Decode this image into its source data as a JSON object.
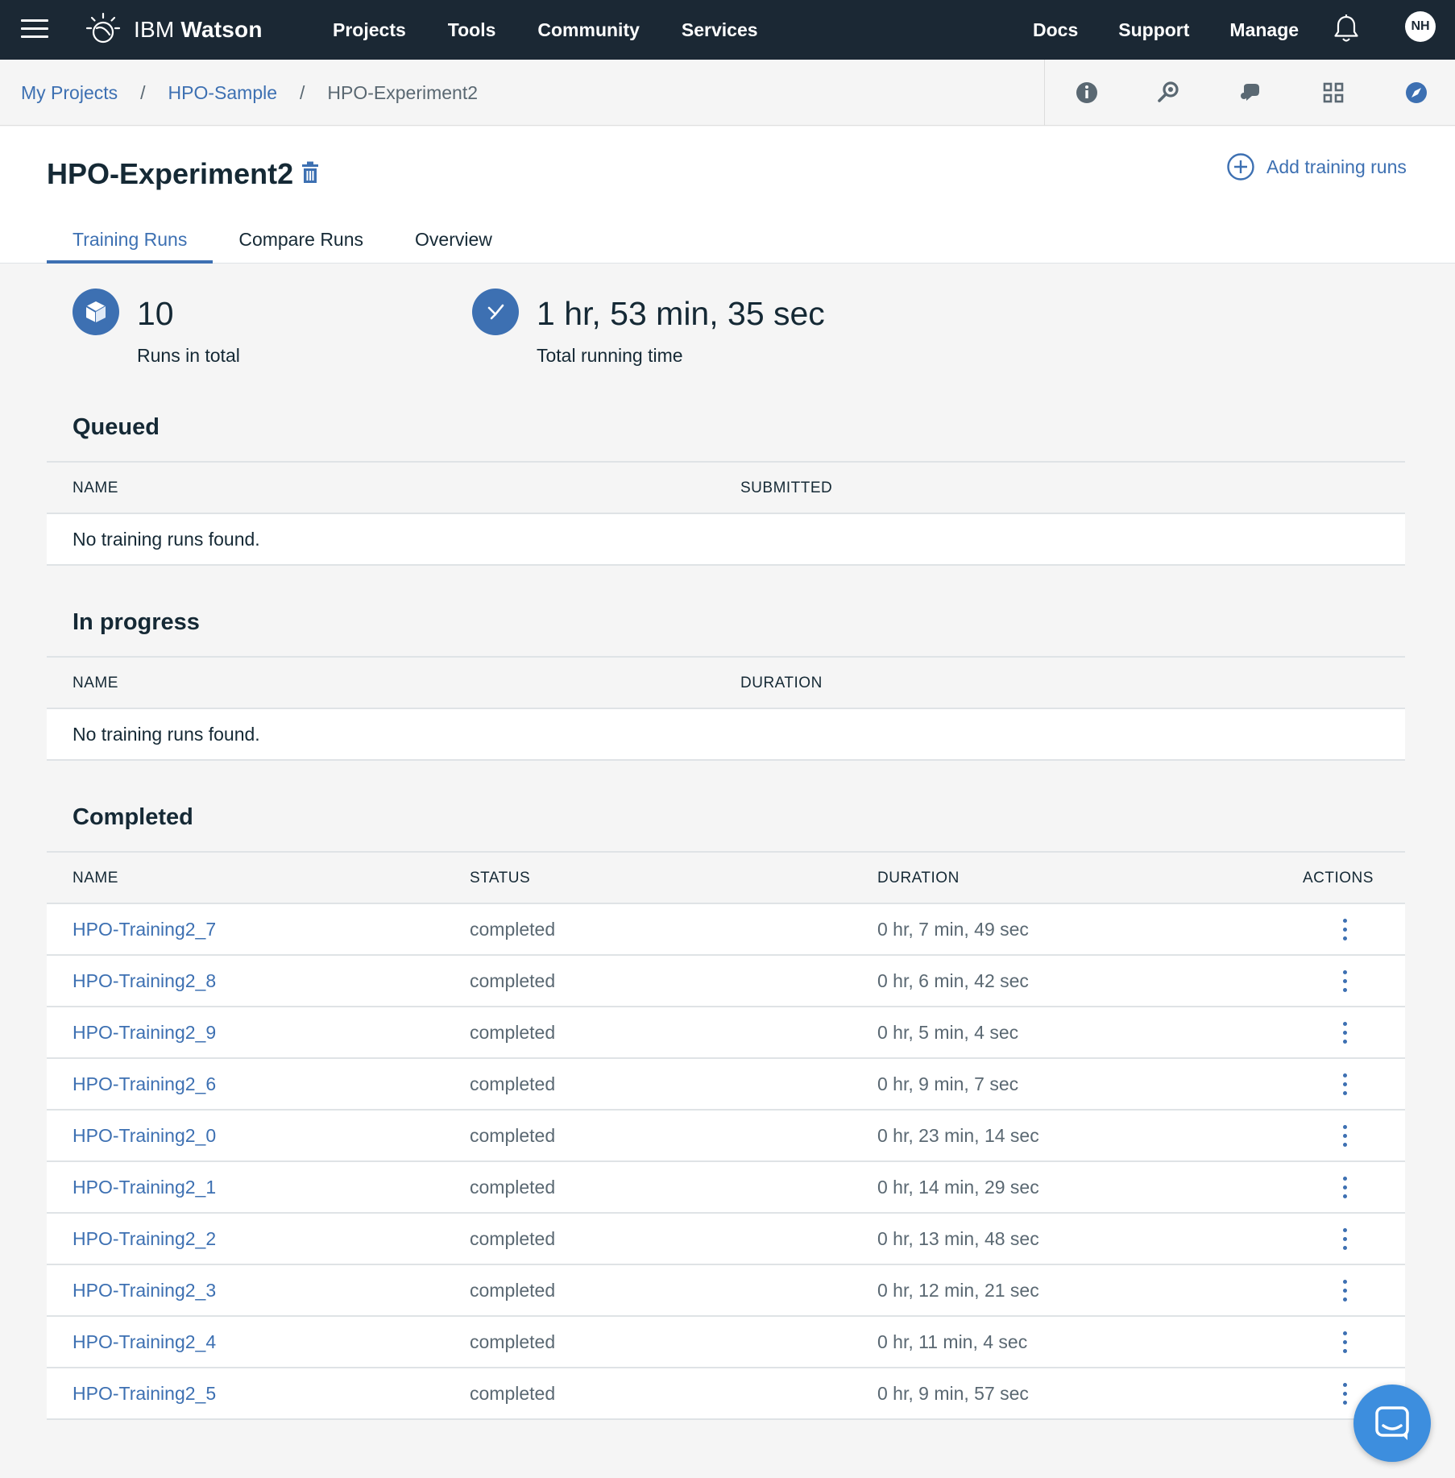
{
  "topnav": {
    "brand_prefix": "IBM",
    "brand_name": "Watson",
    "left_links": [
      "Projects",
      "Tools",
      "Community",
      "Services"
    ],
    "right_links": [
      "Docs",
      "Support",
      "Manage"
    ],
    "avatar_initials": "NH",
    "background": "#1b2834"
  },
  "breadcrumb": {
    "items": [
      "My Projects",
      "HPO-Sample"
    ],
    "current": "HPO-Experiment2",
    "separator": "/"
  },
  "toolbar_icons": [
    "info-icon",
    "search-asset-icon",
    "chat-bubble-icon",
    "grid-icon",
    "compass-icon"
  ],
  "header": {
    "title": "HPO-Experiment2",
    "add_label": "Add training runs",
    "tabs": [
      "Training Runs",
      "Compare Runs",
      "Overview"
    ],
    "active_tab": 0
  },
  "stats": {
    "runs_total": "10",
    "runs_label": "Runs in total",
    "running_time": "1 hr, 53 min, 35 sec",
    "running_label": "Total running time"
  },
  "queued": {
    "title": "Queued",
    "headers": [
      "NAME",
      "SUBMITTED"
    ],
    "empty_text": "No training runs found."
  },
  "in_progress": {
    "title": "In progress",
    "headers": [
      "NAME",
      "DURATION"
    ],
    "empty_text": "No training runs found."
  },
  "completed": {
    "title": "Completed",
    "headers": [
      "NAME",
      "STATUS",
      "DURATION",
      "ACTIONS"
    ],
    "rows": [
      {
        "name": "HPO-Training2_7",
        "status": "completed",
        "duration": "0 hr, 7 min, 49 sec"
      },
      {
        "name": "HPO-Training2_8",
        "status": "completed",
        "duration": "0 hr, 6 min, 42 sec"
      },
      {
        "name": "HPO-Training2_9",
        "status": "completed",
        "duration": "0 hr, 5 min, 4 sec"
      },
      {
        "name": "HPO-Training2_6",
        "status": "completed",
        "duration": "0 hr, 9 min, 7 sec"
      },
      {
        "name": "HPO-Training2_0",
        "status": "completed",
        "duration": "0 hr, 23 min, 14 sec"
      },
      {
        "name": "HPO-Training2_1",
        "status": "completed",
        "duration": "0 hr, 14 min, 29 sec"
      },
      {
        "name": "HPO-Training2_2",
        "status": "completed",
        "duration": "0 hr, 13 min, 48 sec"
      },
      {
        "name": "HPO-Training2_3",
        "status": "completed",
        "duration": "0 hr, 12 min, 21 sec"
      },
      {
        "name": "HPO-Training2_4",
        "status": "completed",
        "duration": "0 hr, 11 min, 4 sec"
      },
      {
        "name": "HPO-Training2_5",
        "status": "completed",
        "duration": "0 hr, 9 min, 57 sec"
      }
    ]
  },
  "colors": {
    "accent": "#3d70b2",
    "text": "#152935",
    "muted": "#5a6872",
    "chat": "#3d8ede"
  }
}
